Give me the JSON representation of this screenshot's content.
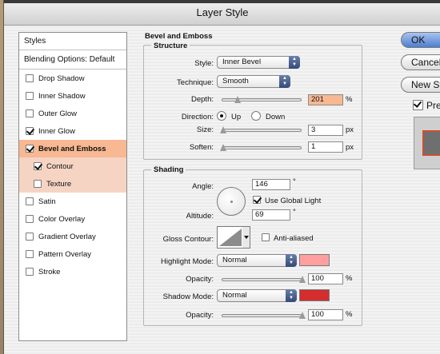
{
  "window": {
    "title": "Layer Style"
  },
  "styles_panel": {
    "header": "Styles",
    "blending": "Blending Options: Default",
    "items": [
      {
        "label": "Drop Shadow",
        "checked": false
      },
      {
        "label": "Inner Shadow",
        "checked": false
      },
      {
        "label": "Outer Glow",
        "checked": false
      },
      {
        "label": "Inner Glow",
        "checked": true
      },
      {
        "label": "Bevel and Emboss",
        "checked": true
      },
      {
        "label": "Contour",
        "checked": true
      },
      {
        "label": "Texture",
        "checked": false
      },
      {
        "label": "Satin",
        "checked": false
      },
      {
        "label": "Color Overlay",
        "checked": false
      },
      {
        "label": "Gradient Overlay",
        "checked": false
      },
      {
        "label": "Pattern Overlay",
        "checked": false
      },
      {
        "label": "Stroke",
        "checked": false
      }
    ]
  },
  "bevel": {
    "group_title": "Bevel and Emboss",
    "structure_title": "Structure",
    "style_label": "Style:",
    "style_value": "Inner Bevel",
    "technique_label": "Technique:",
    "technique_value": "Smooth",
    "depth_label": "Depth:",
    "depth_value": "201",
    "depth_unit": "%",
    "depth_level": 0.2,
    "direction_label": "Direction:",
    "dir_up": "Up",
    "dir_down": "Down",
    "direction_selected": "Up",
    "size_label": "Size:",
    "size_value": "3",
    "size_unit": "px",
    "soften_label": "Soften:",
    "soften_value": "1",
    "soften_unit": "px"
  },
  "shading": {
    "title": "Shading",
    "angle_label": "Angle:",
    "angle_value": "146",
    "degree": "°",
    "global_light_label": "Use Global Light",
    "global_light_checked": true,
    "altitude_label": "Altitude:",
    "altitude_value": "69",
    "gloss_label": "Gloss Contour:",
    "anti_aliased_label": "Anti-aliased",
    "anti_aliased_checked": false,
    "highlight_label": "Highlight Mode:",
    "highlight_value": "Normal",
    "highlight_color": "#ff9f9f",
    "opacity_label": "Opacity:",
    "highlight_opacity": "100",
    "shadow_label": "Shadow Mode:",
    "shadow_value": "Normal",
    "shadow_color": "#d32d2d",
    "shadow_opacity": "100",
    "percent": "%"
  },
  "buttons": {
    "ok": "OK",
    "cancel": "Cancel",
    "new_style": "New Style...",
    "preview": "Preview",
    "preview_checked": true
  }
}
